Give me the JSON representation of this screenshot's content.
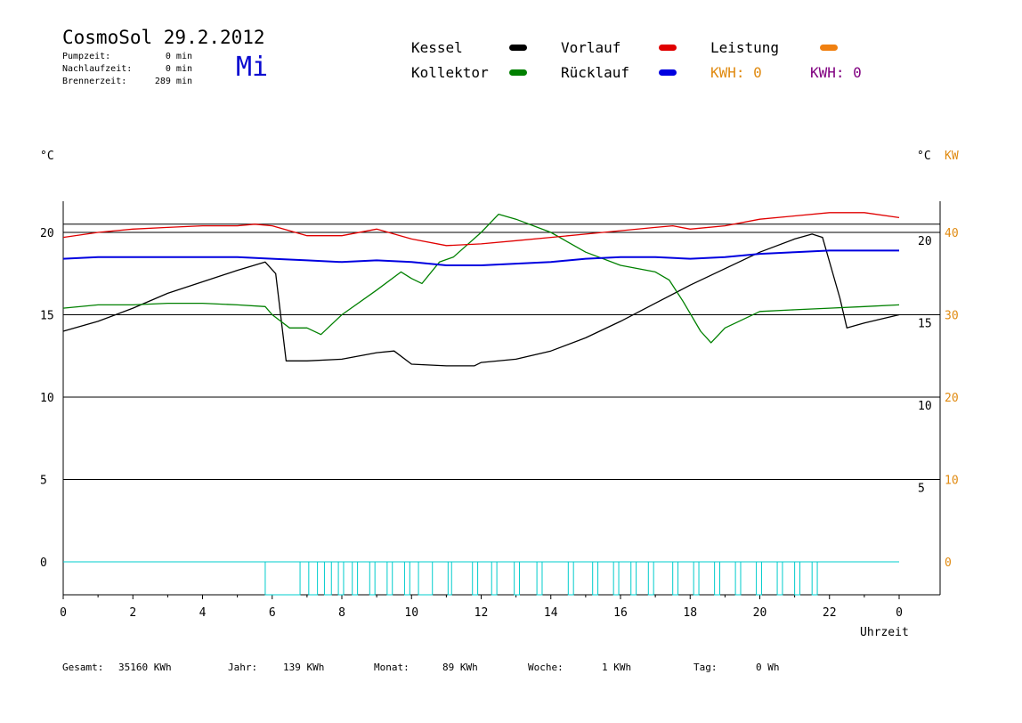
{
  "header": {
    "title": "CosmoSol 29.2.2012",
    "weekday": "Mi",
    "stats": [
      {
        "label": "Pumpzeit:",
        "value": "0 min"
      },
      {
        "label": "Nachlaufzeit:",
        "value": "0 min"
      },
      {
        "label": "Brennerzeit:",
        "value": "289 min"
      }
    ]
  },
  "legend": {
    "kessel": {
      "label": "Kessel",
      "color": "#000000"
    },
    "kollektor": {
      "label": "Kollektor",
      "color": "#008000"
    },
    "vorlauf": {
      "label": "Vorlauf",
      "color": "#e00000"
    },
    "ruecklauf": {
      "label": "Rücklauf",
      "color": "#0000e0"
    },
    "leistung": {
      "label": "Leistung",
      "color": "#f08010"
    },
    "kwh_orange": {
      "label": "KWH: 0",
      "color": "#e08a10"
    },
    "kwh_purple": {
      "label": "KWH: 0",
      "color": "#800080"
    }
  },
  "axis_units": {
    "left": "°C",
    "right_c": "°C",
    "right_kw": "KW"
  },
  "footer": [
    {
      "label": "Gesamt:",
      "value": "35160 KWh"
    },
    {
      "label": "Jahr:",
      "value": "139 KWh"
    },
    {
      "label": "Monat:",
      "value": "89 KWh"
    },
    {
      "label": "Woche:",
      "value": "1 KWh"
    },
    {
      "label": "Tag:",
      "value": "0 Wh"
    }
  ],
  "chart_data": {
    "type": "line",
    "xlabel": "Uhrzeit",
    "x_ticks": [
      "0",
      "2",
      "4",
      "6",
      "8",
      "10",
      "12",
      "14",
      "16",
      "18",
      "20",
      "22",
      "0"
    ],
    "xlim": [
      0,
      24
    ],
    "left_ticks": [
      0,
      5,
      10,
      15,
      20
    ],
    "inner_right_ticks": [
      5,
      10,
      15,
      20
    ],
    "kw_ticks": [
      0,
      10,
      20,
      30,
      40
    ],
    "ylim": [
      -2,
      22
    ],
    "grid": "horizontal",
    "series": [
      {
        "name": "Kessel",
        "color": "#000000",
        "x": [
          0,
          1,
          2,
          3,
          4,
          5,
          5.8,
          6.1,
          6.4,
          7,
          8,
          9,
          9.5,
          10,
          11,
          11.8,
          12,
          13,
          14,
          15,
          16,
          17,
          18,
          19,
          20,
          21,
          21.5,
          21.8,
          22.3,
          22.5,
          23,
          24
        ],
        "y": [
          14,
          14.6,
          15.4,
          16.3,
          17,
          17.7,
          18.2,
          17.5,
          12.2,
          12.2,
          12.3,
          12.7,
          12.8,
          12,
          11.9,
          11.9,
          12.1,
          12.3,
          12.8,
          13.6,
          14.6,
          15.7,
          16.8,
          17.8,
          18.8,
          19.6,
          19.9,
          19.7,
          16,
          14.2,
          14.5,
          15
        ]
      },
      {
        "name": "Kollektor",
        "color": "#008000",
        "x": [
          0,
          1,
          2,
          3,
          4,
          5,
          5.8,
          6,
          6.5,
          7,
          7.4,
          8,
          9,
          9.7,
          10,
          10.3,
          10.8,
          11.2,
          12,
          12.5,
          13,
          14,
          15,
          16,
          17,
          17.4,
          17.8,
          18.3,
          18.6,
          19,
          20,
          21,
          22,
          23,
          24
        ],
        "y": [
          15.4,
          15.6,
          15.6,
          15.7,
          15.7,
          15.6,
          15.5,
          15,
          14.2,
          14.2,
          13.8,
          15,
          16.5,
          17.6,
          17.2,
          16.9,
          18.2,
          18.5,
          20,
          21.1,
          20.8,
          20,
          18.8,
          18,
          17.6,
          17.1,
          15.8,
          14,
          13.3,
          14.2,
          15.2,
          15.3,
          15.4,
          15.5,
          15.6
        ]
      },
      {
        "name": "Vorlauf",
        "color": "#e00000",
        "x": [
          0,
          1,
          2,
          3,
          4,
          5,
          5.5,
          6,
          7,
          8,
          9,
          10,
          11,
          12,
          13,
          14,
          15,
          16,
          17,
          17.5,
          18,
          19,
          20,
          21,
          22,
          23,
          24
        ],
        "y": [
          19.7,
          20,
          20.2,
          20.3,
          20.4,
          20.4,
          20.5,
          20.4,
          19.8,
          19.8,
          20.2,
          19.6,
          19.2,
          19.3,
          19.5,
          19.7,
          19.9,
          20.1,
          20.3,
          20.4,
          20.2,
          20.4,
          20.8,
          21,
          21.2,
          21.2,
          20.9
        ]
      },
      {
        "name": "Rücklauf",
        "color": "#0000e0",
        "x": [
          0,
          1,
          2,
          3,
          4,
          5,
          6,
          7,
          8,
          9,
          10,
          11,
          12,
          13,
          14,
          15,
          16,
          17,
          18,
          19,
          20,
          21,
          22,
          23,
          24
        ],
        "y": [
          18.4,
          18.5,
          18.5,
          18.5,
          18.5,
          18.5,
          18.4,
          18.3,
          18.2,
          18.3,
          18.2,
          18,
          18,
          18.1,
          18.2,
          18.4,
          18.5,
          18.5,
          18.4,
          18.5,
          18.7,
          18.8,
          18.9,
          18.9,
          18.9
        ]
      }
    ],
    "pump_pulses": {
      "color": "#00cccc",
      "baseline": 0,
      "height": -2,
      "intervals": [
        [
          5.8,
          6.8
        ],
        [
          7.05,
          7.3
        ],
        [
          7.5,
          7.7
        ],
        [
          7.9,
          8.05
        ],
        [
          8.3,
          8.45
        ],
        [
          8.8,
          8.95
        ],
        [
          9.3,
          9.45
        ],
        [
          9.8,
          9.95
        ],
        [
          10.2,
          10.6
        ],
        [
          11.05,
          11.15
        ],
        [
          11.75,
          11.9
        ],
        [
          12.3,
          12.45
        ],
        [
          12.95,
          13.1
        ],
        [
          13.6,
          13.75
        ],
        [
          14.5,
          14.65
        ],
        [
          15.2,
          15.35
        ],
        [
          15.8,
          15.95
        ],
        [
          16.3,
          16.45
        ],
        [
          16.8,
          16.95
        ],
        [
          17.5,
          17.65
        ],
        [
          18.1,
          18.25
        ],
        [
          18.7,
          18.85
        ],
        [
          19.3,
          19.45
        ],
        [
          19.9,
          20.05
        ],
        [
          20.5,
          20.65
        ],
        [
          21,
          21.15
        ],
        [
          21.5,
          21.65
        ]
      ]
    }
  }
}
